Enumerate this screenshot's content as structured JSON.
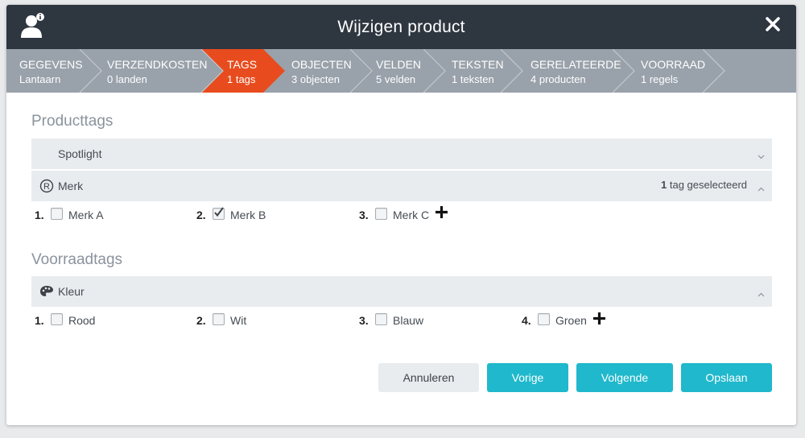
{
  "dialog": {
    "title": "Wijzigen product"
  },
  "steps": [
    {
      "title": "GEGEVENS",
      "sub": "Lantaarn"
    },
    {
      "title": "VERZENDKOSTEN",
      "sub": "0 landen"
    },
    {
      "title": "TAGS",
      "sub": "1 tags"
    },
    {
      "title": "OBJECTEN",
      "sub": "3 objecten"
    },
    {
      "title": "VELDEN",
      "sub": "5 velden"
    },
    {
      "title": "TEKSTEN",
      "sub": "1 teksten"
    },
    {
      "title": "GERELATEERDE",
      "sub": "4 producten"
    },
    {
      "title": "VOORRAAD",
      "sub": "1 regels"
    }
  ],
  "active_step_index": 2,
  "colors": {
    "header": "#2e3640",
    "steps": "#99a1aa",
    "active": "#e84c1e",
    "primary": "#20b8cc"
  },
  "producttags": {
    "title": "Producttags",
    "spotlight": {
      "label": "Spotlight"
    },
    "merk": {
      "label": "Merk",
      "count": "1",
      "count_suffix": "tag geselecteerd",
      "options": [
        {
          "num": "1.",
          "label": "Merk A",
          "checked": false
        },
        {
          "num": "2.",
          "label": "Merk B",
          "checked": true
        },
        {
          "num": "3.",
          "label": "Merk C",
          "checked": false
        }
      ]
    }
  },
  "voorraadtags": {
    "title": "Voorraadtags",
    "kleur": {
      "label": "Kleur",
      "options": [
        {
          "num": "1.",
          "label": "Rood",
          "checked": false
        },
        {
          "num": "2.",
          "label": "Wit",
          "checked": false
        },
        {
          "num": "3.",
          "label": "Blauw",
          "checked": false
        },
        {
          "num": "4.",
          "label": "Groen",
          "checked": false
        }
      ]
    }
  },
  "buttons": {
    "cancel": "Annuleren",
    "prev": "Vorige",
    "next": "Volgende",
    "save": "Opslaan"
  }
}
